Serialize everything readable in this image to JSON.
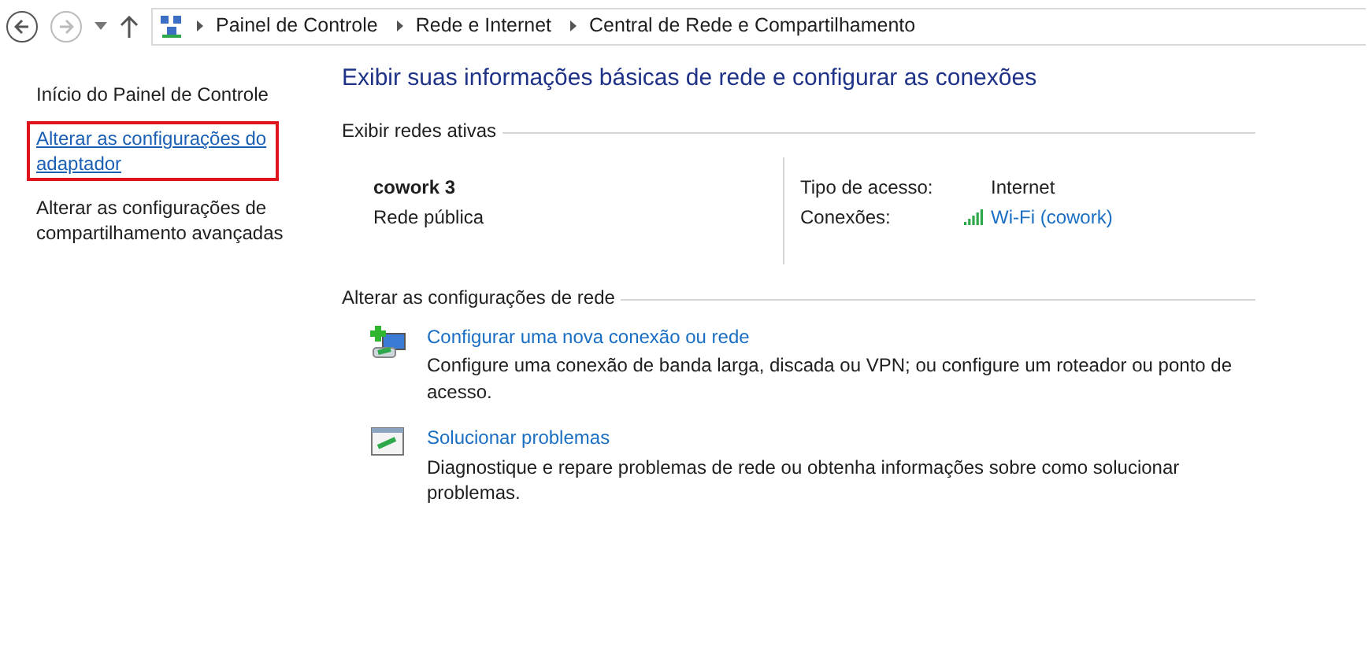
{
  "breadcrumb": [
    "Painel de Controle",
    "Rede e Internet",
    "Central de Rede e Compartilhamento"
  ],
  "sidebar": {
    "items": [
      {
        "label": "Início do Painel de Controle",
        "link": false,
        "highlighted": false
      },
      {
        "label": "Alterar as configurações do adaptador",
        "link": true,
        "highlighted": true
      },
      {
        "label": "Alterar as configurações de compartilhamento avançadas",
        "link": false,
        "highlighted": false
      }
    ]
  },
  "title": "Exibir suas informações básicas de rede e configurar as conexões",
  "active_networks": {
    "heading": "Exibir redes ativas",
    "name": "cowork  3",
    "type": "Rede pública",
    "details": [
      {
        "label": "Tipo de acesso:",
        "value": "Internet",
        "kind": "text"
      },
      {
        "label": "Conexões:",
        "value": "Wi-Fi (cowork)",
        "kind": "wifi-link"
      }
    ]
  },
  "change_settings": {
    "heading": "Alterar as configurações de rede",
    "tasks": [
      {
        "kind": "new-connection",
        "link": "Configurar uma nova conexão ou rede",
        "description": "Configure uma conexão de banda larga, discada ou VPN; ou configure um roteador ou ponto de acesso."
      },
      {
        "kind": "troubleshoot",
        "link": "Solucionar problemas",
        "description": "Diagnostique e repare problemas de rede ou obtenha informações sobre como solucionar problemas."
      }
    ]
  }
}
